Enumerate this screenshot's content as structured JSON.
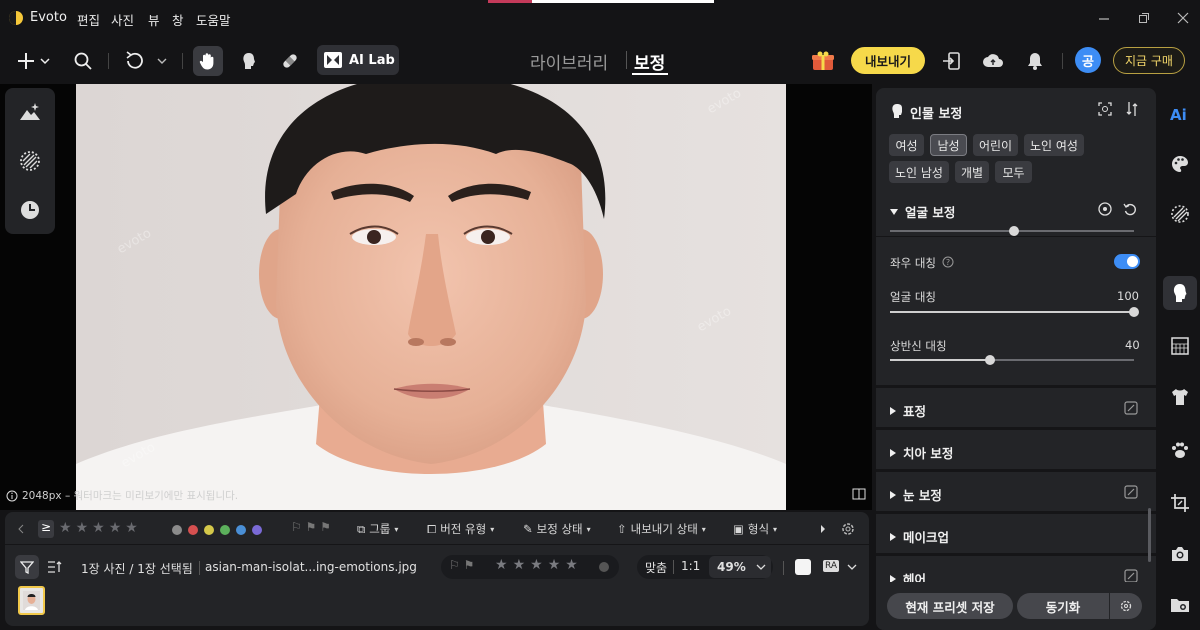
{
  "app": {
    "name": "Evoto"
  },
  "menu": [
    "편집",
    "사진",
    "뷰",
    "창",
    "도움말"
  ],
  "toolbar": {
    "ai_lab_label": "AI Lab",
    "tabs": {
      "library": "라이브러리",
      "edit": "보정"
    },
    "export_label": "내보내기",
    "avatar_initial": "공",
    "buy_label": "지금 구매"
  },
  "canvas": {
    "info_text": "2048px – 워터마크는 미리보기에만 표시됩니다.",
    "watermark": "evoto"
  },
  "filmstrip": {
    "filter_symbol": "≥",
    "rating_filter_stars": 5,
    "color_labels": [
      "#8b8b8b",
      "#d65050",
      "#d4c84a",
      "#5cb05c",
      "#4a8fd6",
      "#7a6ad6"
    ],
    "filters": [
      "그룹",
      "버전 유형",
      "보정 상태",
      "내보내기 상태",
      "형식"
    ],
    "status_text": "1장 사진 / 1장 선택됨",
    "filename": "asian-man-isolat...ing-emotions.jpg",
    "fit_label": "맞춤",
    "one_to_one": "1:1",
    "zoom": "49%",
    "raw_label": "RA"
  },
  "panel": {
    "title": "인물 보정",
    "chips_row1": [
      "여성",
      "남성",
      "어린이",
      "노인 여성"
    ],
    "chips_row2": [
      "노인 남성",
      "개별",
      "모두"
    ],
    "selected_chip": "남성",
    "face_section": "얼굴 보정",
    "symmetry_label": "좌우 대칭",
    "symmetry_on": true,
    "face_sym_label": "얼굴 대칭",
    "face_sym_value": "100",
    "face_sym_fraction": 1.0,
    "body_sym_label": "상반신 대칭",
    "body_sym_value": "40",
    "body_sym_fraction": 0.41,
    "sections": [
      "표정",
      "치아 보정",
      "눈 보정",
      "메이크업",
      "헤어"
    ],
    "save_preset": "현재 프리셋 저장",
    "sync": "동기화"
  },
  "colors": {
    "accent_blue": "#3d8df5",
    "export_yellow": "#f6d94a",
    "thumb_border": "#f1c84a"
  }
}
